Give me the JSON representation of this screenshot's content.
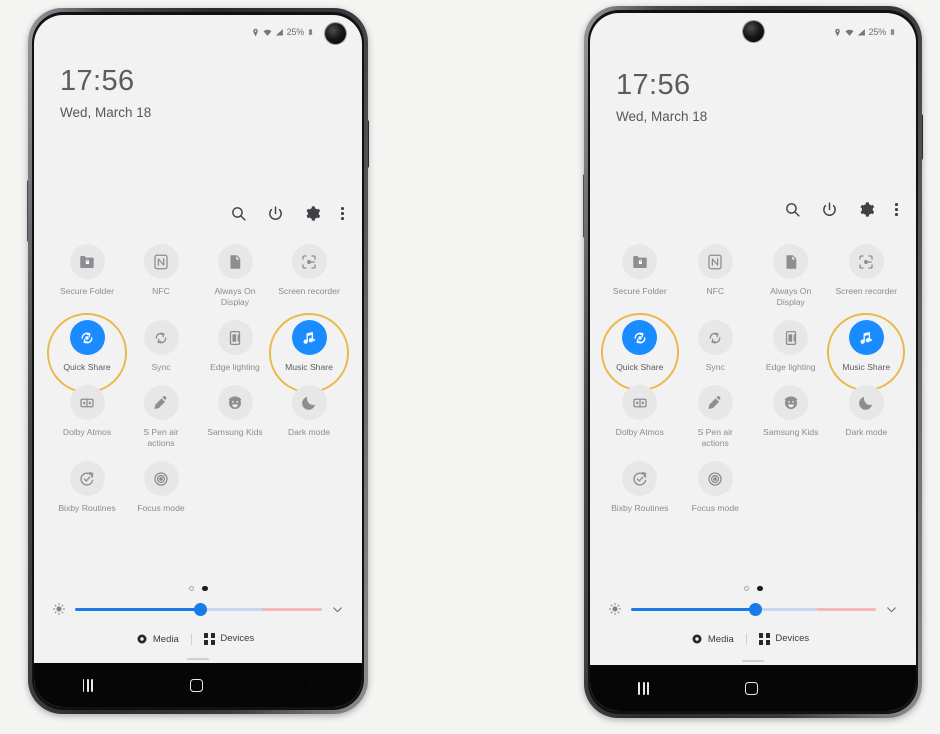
{
  "phones": [
    {
      "id": "galaxy-s-style",
      "camera_position": "right",
      "status_bar": {
        "icons": [
          "location-icon",
          "wifi-icon",
          "signal-icon"
        ],
        "battery_percent": "25%",
        "battery_icon": "battery-icon"
      },
      "clock": {
        "time": "17:56",
        "date": "Wed, March 18"
      },
      "toolbar": [
        {
          "name": "search-icon",
          "label": "Search"
        },
        {
          "name": "power-icon",
          "label": "Power"
        },
        {
          "name": "settings-gear-icon",
          "label": "Settings"
        },
        {
          "name": "more-options-icon",
          "label": "More options"
        }
      ],
      "tiles": [
        [
          {
            "label": "Secure\nFolder",
            "icon": "secure-folder-icon",
            "active": false,
            "highlighted": false
          },
          {
            "label": "NFC",
            "icon": "nfc-icon",
            "active": false,
            "highlighted": false
          },
          {
            "label": "Always On\nDisplay",
            "icon": "always-on-display-icon",
            "active": false,
            "highlighted": false
          },
          {
            "label": "Screen\nrecorder",
            "icon": "screen-recorder-icon",
            "active": false,
            "highlighted": false
          }
        ],
        [
          {
            "label": "Quick Share",
            "icon": "quick-share-icon",
            "active": true,
            "highlighted": true
          },
          {
            "label": "Sync",
            "icon": "sync-icon",
            "active": false,
            "highlighted": false
          },
          {
            "label": "Edge lighting",
            "icon": "edge-lighting-icon",
            "active": false,
            "highlighted": false
          },
          {
            "label": "Music Share",
            "icon": "music-share-icon",
            "active": true,
            "highlighted": true
          }
        ],
        [
          {
            "label": "Dolby\nAtmos",
            "icon": "dolby-atmos-icon",
            "active": false,
            "highlighted": false
          },
          {
            "label": "S Pen air\nactions",
            "icon": "s-pen-icon",
            "active": false,
            "highlighted": false
          },
          {
            "label": "Samsung\nKids",
            "icon": "samsung-kids-icon",
            "active": false,
            "highlighted": false
          },
          {
            "label": "Dark mode",
            "icon": "dark-mode-moon-icon",
            "active": false,
            "highlighted": false
          }
        ],
        [
          {
            "label": "Bixby\nRoutines",
            "icon": "bixby-routines-icon",
            "active": false,
            "highlighted": false
          },
          {
            "label": "Focus mode",
            "icon": "focus-mode-icon",
            "active": false,
            "highlighted": false
          }
        ]
      ],
      "page_dots": {
        "count": 2,
        "active_index": 1
      },
      "brightness": {
        "icon": "brightness-icon",
        "value_percent": 51,
        "expand_icon": "chevron-down-icon"
      },
      "media_bar": {
        "media_label": "Media",
        "media_icon": "media-play-icon",
        "devices_label": "Devices",
        "devices_icon": "devices-grid-icon"
      },
      "nav_bar": [
        {
          "name": "recents-button",
          "icon": "recents-icon"
        },
        {
          "name": "home-button",
          "icon": "home-square-icon"
        },
        {
          "name": "back-button",
          "icon": "back-chevron-icon"
        }
      ]
    },
    {
      "id": "galaxy-note-style",
      "camera_position": "center",
      "status_bar": {
        "icons": [
          "location-icon",
          "wifi-icon",
          "signal-icon"
        ],
        "battery_percent": "25%",
        "battery_icon": "battery-icon"
      },
      "clock": {
        "time": "17:56",
        "date": "Wed, March 18"
      },
      "toolbar": [
        {
          "name": "search-icon",
          "label": "Search"
        },
        {
          "name": "power-icon",
          "label": "Power"
        },
        {
          "name": "settings-gear-icon",
          "label": "Settings"
        },
        {
          "name": "more-options-icon",
          "label": "More options"
        }
      ],
      "tiles": [
        [
          {
            "label": "Secure\nFolder",
            "icon": "secure-folder-icon",
            "active": false,
            "highlighted": false
          },
          {
            "label": "NFC",
            "icon": "nfc-icon",
            "active": false,
            "highlighted": false
          },
          {
            "label": "Always On\nDisplay",
            "icon": "always-on-display-icon",
            "active": false,
            "highlighted": false
          },
          {
            "label": "Screen\nrecorder",
            "icon": "screen-recorder-icon",
            "active": false,
            "highlighted": false
          }
        ],
        [
          {
            "label": "Quick Share",
            "icon": "quick-share-icon",
            "active": true,
            "highlighted": true
          },
          {
            "label": "Sync",
            "icon": "sync-icon",
            "active": false,
            "highlighted": false
          },
          {
            "label": "Edge lighting",
            "icon": "edge-lighting-icon",
            "active": false,
            "highlighted": false
          },
          {
            "label": "Music Share",
            "icon": "music-share-icon",
            "active": true,
            "highlighted": true
          }
        ],
        [
          {
            "label": "Dolby\nAtmos",
            "icon": "dolby-atmos-icon",
            "active": false,
            "highlighted": false
          },
          {
            "label": "S Pen air\nactions",
            "icon": "s-pen-icon",
            "active": false,
            "highlighted": false
          },
          {
            "label": "Samsung\nKids",
            "icon": "samsung-kids-icon",
            "active": false,
            "highlighted": false
          },
          {
            "label": "Dark mode",
            "icon": "dark-mode-moon-icon",
            "active": false,
            "highlighted": false
          }
        ],
        [
          {
            "label": "Bixby\nRoutines",
            "icon": "bixby-routines-icon",
            "active": false,
            "highlighted": false
          },
          {
            "label": "Focus mode",
            "icon": "focus-mode-icon",
            "active": false,
            "highlighted": false
          }
        ]
      ],
      "page_dots": {
        "count": 2,
        "active_index": 1
      },
      "brightness": {
        "icon": "brightness-icon",
        "value_percent": 51,
        "expand_icon": "chevron-down-icon"
      },
      "media_bar": {
        "media_label": "Media",
        "media_icon": "media-play-icon",
        "devices_label": "Devices",
        "devices_icon": "devices-grid-icon"
      },
      "nav_bar": [
        {
          "name": "recents-button",
          "icon": "recents-icon"
        },
        {
          "name": "home-button",
          "icon": "home-square-icon"
        },
        {
          "name": "back-button",
          "icon": "back-chevron-icon"
        }
      ]
    }
  ],
  "colors": {
    "accent_blue": "#1a8cff",
    "highlight_ring": "#e9b949",
    "slider_blue": "#1a7ae8",
    "slider_tail": "#f3b9b4",
    "tile_off_bg": "#e7e7e7",
    "screen_bg": "#f2f2f2",
    "page_bg": "#f4f4f2"
  }
}
